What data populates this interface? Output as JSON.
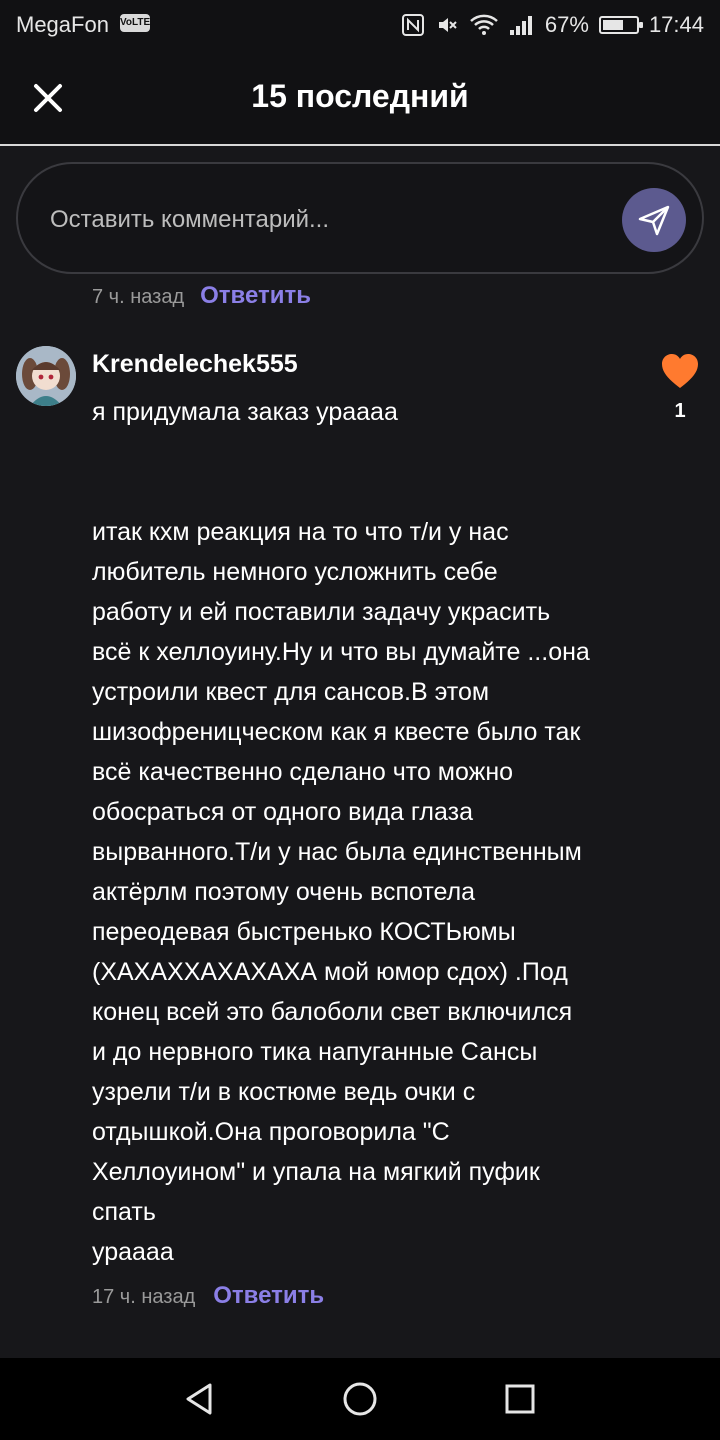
{
  "status_bar": {
    "carrier": "MegaFon",
    "volte_badge": "VoLTE",
    "battery": "67%",
    "battery_level": 0.67,
    "time": "17:44",
    "icons": [
      "nfc-icon",
      "mute-icon",
      "wifi-icon",
      "signal-icon",
      "battery-icon"
    ]
  },
  "header": {
    "title": "15 последний",
    "close_icon": "close-icon"
  },
  "comment_input": {
    "placeholder": "Оставить комментарий...",
    "send_icon": "send-icon"
  },
  "previous_comment": {
    "time": "7 ч. назад",
    "reply_label": "Ответить"
  },
  "comment": {
    "username": "Krendelechek555",
    "text": "я придумала заказ ураааа\n\n\nитак кхм реакция на то что т/и у нас\nлюбитель немного усложнить себе\nработу и ей поставили задачу украсить\nвсё к хеллоуину.Ну и что вы думайте ...она\nустроили квест для сансов.В этом\nшизофреницческом как я квесте было так\nвсё качественно сделано что можно\nобосраться от одного вида глаза\nвырванного.Т/и у нас была единственным\nактёрлм поэтому очень вспотела\nпереодевая быстренько КОСТЬюмы\n(ХАХАХХАХАХАХА мой юмор сдох) .Под\nконец всей это балоболи свет включился\nи до нервного тика напуганные Сансы\nузрели т/и в костюме ведь очки с\nотдышкой.Она проговорила \"С\nХеллоуином\" и упала на мягкий пуфик\nспать\nураааа",
    "likes": "1",
    "time": "17 ч. назад",
    "reply_label": "Ответить"
  },
  "colors": {
    "background": "#17171a",
    "accent": "#8b7fe6",
    "send_button": "#5c5a8f",
    "like": "#ff7a2f"
  }
}
